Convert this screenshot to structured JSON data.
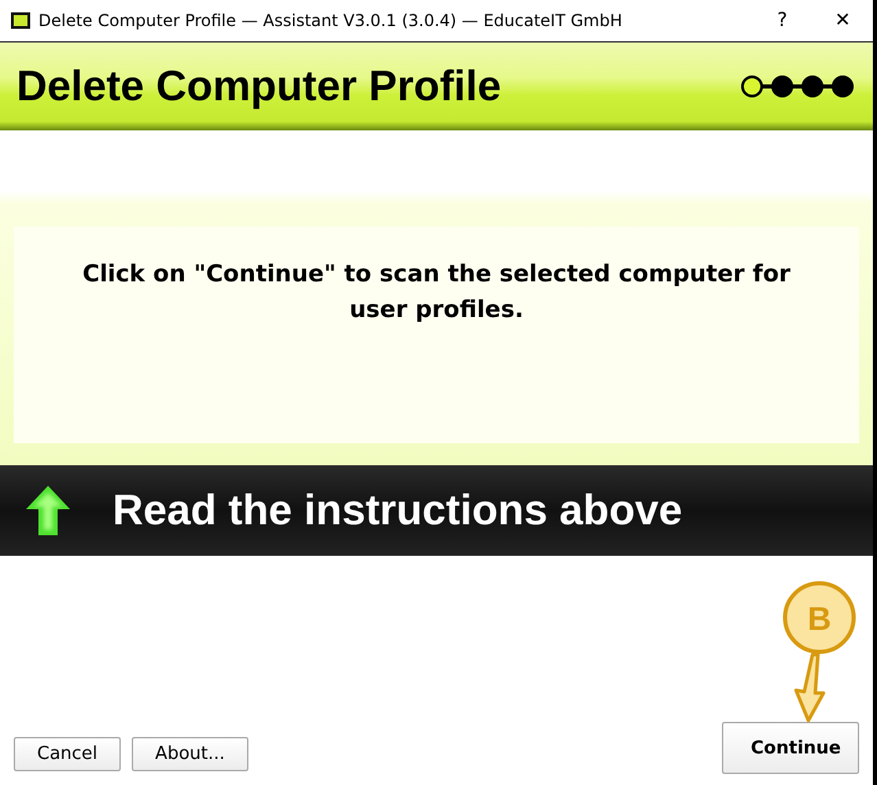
{
  "window": {
    "title": "Delete Computer Profile — Assistant V3.0.1 (3.0.4) — EducateIT GmbH",
    "help": "?",
    "close": "✕"
  },
  "header": {
    "title": "Delete Computer Profile",
    "steps": [
      {
        "selected": true
      },
      {
        "selected": false
      },
      {
        "selected": false
      },
      {
        "selected": false
      }
    ]
  },
  "message": "Click on \"Continue\" to scan the selected computer for user profiles.",
  "banner": {
    "text": "Read the instructions above"
  },
  "buttons": [
    {
      "label": "Cancel",
      "kind": "secondary"
    },
    {
      "label": "About...",
      "kind": "secondary"
    },
    {
      "label": "Continue",
      "kind": "primary"
    }
  ],
  "callout": {
    "label": "B"
  }
}
